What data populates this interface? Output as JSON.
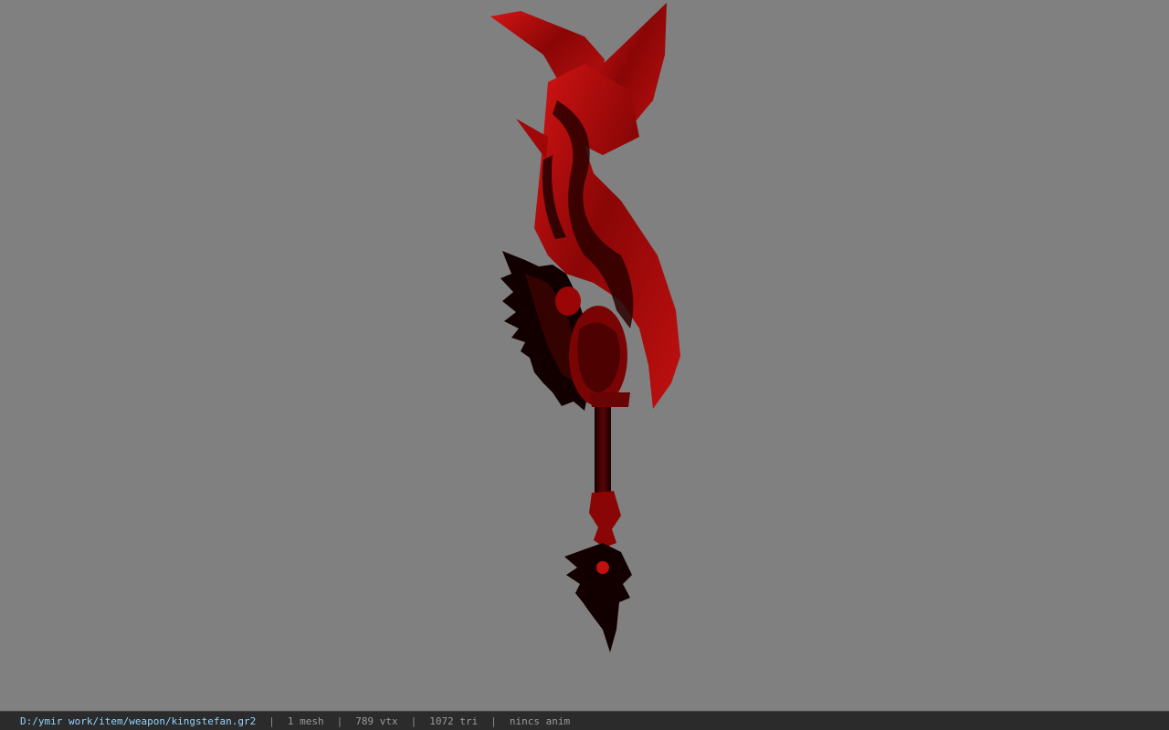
{
  "viewer": {
    "background_color": "#808080",
    "model_colors": {
      "primary": "#b00a0a",
      "dark": "#3a0000",
      "black": "#0a0000",
      "highlight": "#e21a1a"
    }
  },
  "statusbar": {
    "file_path": "D:/ymir work/item/weapon/kingstefan.gr2",
    "separator": "|",
    "mesh": "1 mesh",
    "vertices": "789 vtx",
    "triangles": "1072 tri",
    "animation": "nincs anim"
  }
}
